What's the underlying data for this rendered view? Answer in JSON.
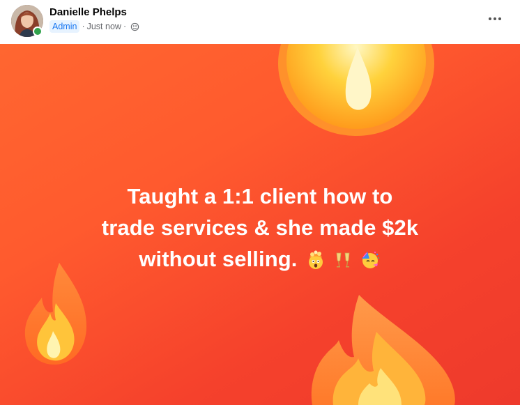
{
  "author": {
    "name": "Danielle Phelps",
    "badge": "Admin",
    "timestamp": "Just now",
    "separator": "·",
    "audience_icon": "globe-icon"
  },
  "post": {
    "caption_lines": [
      "Taught a 1:1 client how to",
      "trade services & she made $2k",
      "without selling."
    ],
    "emojis": [
      "exploding-head-emoji",
      "clinking-glasses-emoji",
      "partying-face-emoji"
    ]
  },
  "colors": {
    "background_top": "#ff6630",
    "background_bottom": "#ee3a2c",
    "admin_badge_text": "#1877f2",
    "online": "#31a24c"
  }
}
